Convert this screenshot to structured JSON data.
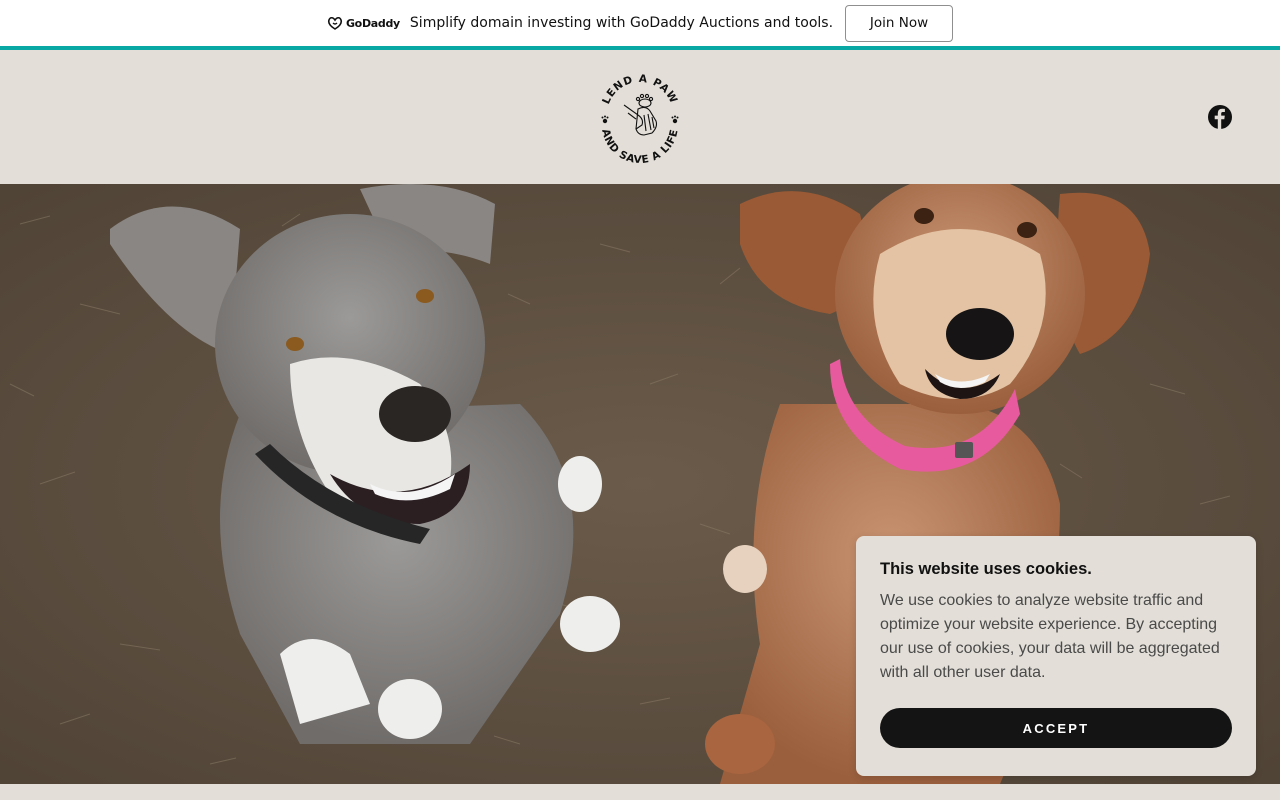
{
  "promo": {
    "brand": "GoDaddy",
    "text": "Simplify domain investing with GoDaddy Auctions and tools.",
    "button_label": "Join Now"
  },
  "header": {
    "logo": {
      "top_text": "LEND A PAW",
      "bottom_text": "AND SAVE A LIFE",
      "icon": "hands-and-paw-icon"
    },
    "social_icon": "facebook-icon"
  },
  "hero": {
    "image": "two-dogs-photo"
  },
  "cookie": {
    "title": "This website uses cookies.",
    "body": "We use cookies to analyze website traffic and optimize your website experience. By accepting our use of cookies, your data will be aggregated with all other user data.",
    "accept_label": "ACCEPT"
  },
  "colors": {
    "accent": "#09a8a4",
    "background": "#e3dfd8",
    "button": "#141414"
  }
}
